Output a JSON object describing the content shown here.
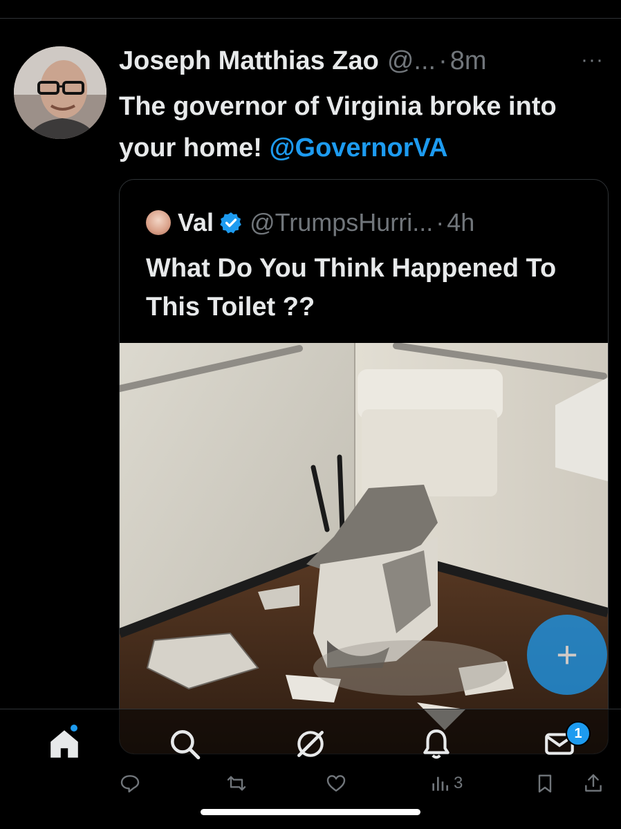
{
  "tweet": {
    "author_name": "Joseph Matthias Zao",
    "author_handle": "@...",
    "separator": "·",
    "time": "8m",
    "more": "···",
    "text": "The governor of Virginia broke into your home!",
    "mention": "@GovernorVA"
  },
  "quoted": {
    "author_name": "Val",
    "verified": true,
    "author_handle": "@TrumpsHurri...",
    "separator": "·",
    "time": "4h",
    "text": "What Do You Think Happened To This Toilet ??",
    "media": "photo of a smashed toilet in a bathroom"
  },
  "compose_button": {
    "label": "+"
  },
  "tabbar": {
    "items": [
      {
        "icon": "home-icon",
        "active": true,
        "notification_dot": true
      },
      {
        "icon": "search-icon"
      },
      {
        "icon": "grok-icon"
      },
      {
        "icon": "bell-icon"
      },
      {
        "icon": "mail-icon",
        "badge": "1"
      }
    ]
  },
  "actions": {
    "reply_icon": "reply-icon",
    "repost_icon": "repost-icon",
    "like_icon": "heart-icon",
    "views_icon": "views-icon",
    "views_count": "3",
    "bookmark_icon": "bookmark-icon",
    "share_icon": "share-icon"
  },
  "colors": {
    "background": "#000000",
    "primary_text": "#e7e9ea",
    "secondary_text": "#71767b",
    "accent": "#1d9bf0",
    "border": "#2f3336"
  }
}
